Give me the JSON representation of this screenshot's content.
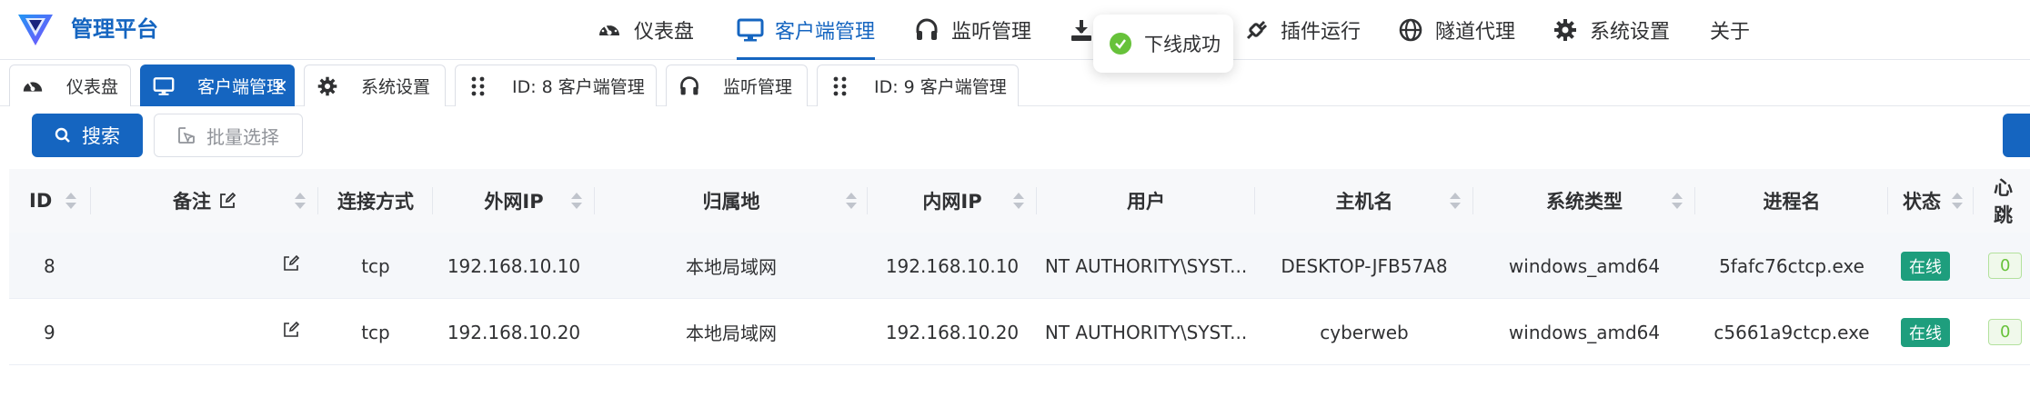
{
  "app": {
    "title": "管理平台"
  },
  "nav": {
    "items": [
      {
        "label": "仪表盘",
        "icon": "gauge-icon"
      },
      {
        "label": "客户端管理",
        "icon": "monitor-icon",
        "active": true
      },
      {
        "label": "监听管理",
        "icon": "headphones-icon"
      },
      {
        "label": "",
        "icon": "download-icon"
      },
      {
        "label": "插件运行",
        "icon": "plugin-icon"
      },
      {
        "label": "隧道代理",
        "icon": "globe-icon"
      },
      {
        "label": "系统设置",
        "icon": "gear-icon"
      },
      {
        "label": "关于",
        "icon": ""
      }
    ]
  },
  "toast": {
    "text": "下线成功",
    "icon": "check-circle-icon",
    "color": "#67c23a"
  },
  "tabs": [
    {
      "label": "仪表盘",
      "icon": "gauge-icon"
    },
    {
      "label": "客户端管理",
      "icon": "monitor-icon",
      "active": true,
      "close": "×"
    },
    {
      "label": "系统设置",
      "icon": "gear-icon"
    },
    {
      "label": "ID: 8 客户端管理",
      "icon": "grid-icon"
    },
    {
      "label": "监听管理",
      "icon": "headphones-icon"
    },
    {
      "label": "ID: 9 客户端管理",
      "icon": "grid-icon"
    }
  ],
  "toolbar": {
    "search_label": "搜索",
    "batch_label": "批量选择"
  },
  "table": {
    "columns": [
      "ID",
      "备注",
      "连接方式",
      "外网IP",
      "归属地",
      "内网IP",
      "用户",
      "主机名",
      "系统类型",
      "进程名",
      "状态",
      "心跳"
    ],
    "rows": [
      {
        "id": "8",
        "note": "",
        "conn": "tcp",
        "wan_ip": "192.168.10.10",
        "location": "本地局域网",
        "lan_ip": "192.168.10.10",
        "user": "NT AUTHORITY\\SYST...",
        "host": "DESKTOP-JFB57A8",
        "os": "windows_amd64",
        "proc": "5fafc76ctcp.exe",
        "status": "在线",
        "beat": "0"
      },
      {
        "id": "9",
        "note": "",
        "conn": "tcp",
        "wan_ip": "192.168.10.20",
        "location": "本地局域网",
        "lan_ip": "192.168.10.20",
        "user": "NT AUTHORITY\\SYST...",
        "host": "cyberweb",
        "os": "windows_amd64",
        "proc": "c5661a9ctcp.exe",
        "status": "在线",
        "beat": "0"
      }
    ]
  },
  "colors": {
    "primary": "#1565c0",
    "success": "#1e9e7d",
    "heartbeat": "#67c23a"
  }
}
